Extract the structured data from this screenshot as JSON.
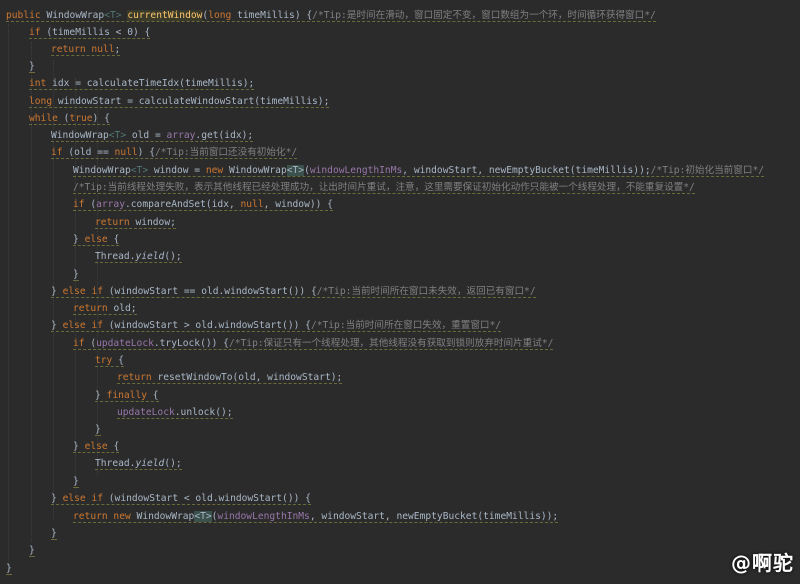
{
  "code_lines": [
    [
      [
        "kw",
        "public "
      ],
      [
        "pl",
        "WindowWrap"
      ],
      [
        "ty",
        "<T>"
      ],
      [
        "pl",
        " "
      ],
      [
        "hl",
        "currentWindow"
      ],
      [
        "pl",
        "("
      ],
      [
        "kw",
        "long "
      ],
      [
        "pl",
        "timeMillis) {"
      ],
      [
        "cm",
        "/*Tip:是时间在滑动，窗口固定不变，窗口数组为一个环，时间循环获得窗口*/"
      ]
    ],
    [
      [
        "kw",
        "if "
      ],
      [
        "pl",
        "(timeMillis < 0) {"
      ]
    ],
    [
      [
        "kw",
        "return null"
      ],
      [
        "pl",
        ";"
      ]
    ],
    [
      [
        "pl",
        "}"
      ]
    ],
    [
      [
        "kw",
        "int "
      ],
      [
        "pl",
        "idx = calculateTimeIdx(timeMillis);"
      ]
    ],
    [
      [
        "kw",
        "long "
      ],
      [
        "pl",
        "windowStart = calculateWindowStart(timeMillis);"
      ]
    ],
    [
      [
        "kw",
        "while "
      ],
      [
        "pl",
        "("
      ],
      [
        "kw",
        "true"
      ],
      [
        "pl",
        ") {"
      ]
    ],
    [
      [
        "pl",
        "WindowWrap"
      ],
      [
        "ty",
        "<T>"
      ],
      [
        "pl",
        " old = "
      ],
      [
        "fi",
        "array"
      ],
      [
        "pl",
        ".get(idx);"
      ]
    ],
    [
      [
        "kw",
        "if "
      ],
      [
        "pl",
        "(old == "
      ],
      [
        "kw",
        "null"
      ],
      [
        "pl",
        ") {"
      ],
      [
        "cm",
        "/*Tip:当前窗口还没有初始化*/"
      ]
    ],
    [
      [
        "pl",
        "WindowWrap"
      ],
      [
        "ty",
        "<T>"
      ],
      [
        "pl",
        " window = "
      ],
      [
        "kw",
        "new "
      ],
      [
        "pl",
        "WindowWrap"
      ],
      [
        "br",
        "<T>"
      ],
      [
        "pl",
        "("
      ],
      [
        "fi",
        "windowLengthInMs"
      ],
      [
        "pl",
        ", windowStart, newEmptyBucket(timeMillis));"
      ],
      [
        "cm",
        "/*Tip:初始化当前窗口*/"
      ]
    ],
    [
      [
        "cm",
        "/*Tip:当前线程处理失败，表示其他线程已经处理成功，让出时间片重试，注意，这里需要保证初始化动作只能被一个线程处理，不能重复设置*/"
      ]
    ],
    [
      [
        "kw",
        "if "
      ],
      [
        "pl",
        "("
      ],
      [
        "fi",
        "array"
      ],
      [
        "pl",
        ".compareAndSet(idx, "
      ],
      [
        "kw",
        "null"
      ],
      [
        "pl",
        ", window)) {"
      ]
    ],
    [
      [
        "kw",
        "return "
      ],
      [
        "pl",
        "window;"
      ]
    ],
    [
      [
        "pl",
        "} "
      ],
      [
        "kw",
        "else "
      ],
      [
        "pl",
        "{"
      ]
    ],
    [
      [
        "pl",
        "Thread."
      ],
      [
        "it",
        "yield"
      ],
      [
        "pl",
        "();"
      ]
    ],
    [
      [
        "pl",
        "}"
      ]
    ],
    [
      [
        "pl",
        "} "
      ],
      [
        "kw",
        "else if "
      ],
      [
        "pl",
        "(windowStart == old.windowStart()) {"
      ],
      [
        "cm",
        "/*Tip:当前时间所在窗口未失效，返回已有窗口*/"
      ]
    ],
    [
      [
        "kw",
        "return "
      ],
      [
        "pl",
        "old;"
      ]
    ],
    [
      [
        "pl",
        "} "
      ],
      [
        "kw",
        "else if "
      ],
      [
        "pl",
        "(windowStart > old.windowStart()) {"
      ],
      [
        "cm",
        "/*Tip:当前时间所在窗口失效，重置窗口*/"
      ]
    ],
    [
      [
        "kw",
        "if "
      ],
      [
        "pl",
        "("
      ],
      [
        "fi",
        "updateLock"
      ],
      [
        "pl",
        ".tryLock()) {"
      ],
      [
        "cm",
        "/*Tip:保证只有一个线程处理，其他线程没有获取到锁则放弃时间片重试*/"
      ]
    ],
    [
      [
        "kw",
        "try "
      ],
      [
        "pl",
        "{"
      ]
    ],
    [
      [
        "kw",
        "return "
      ],
      [
        "pl",
        "resetWindowTo(old, windowStart);"
      ]
    ],
    [
      [
        "pl",
        "} "
      ],
      [
        "kw",
        "finally "
      ],
      [
        "pl",
        "{"
      ]
    ],
    [
      [
        "fi",
        "updateLock"
      ],
      [
        "pl",
        ".unlock();"
      ]
    ],
    [
      [
        "pl",
        "}"
      ]
    ],
    [
      [
        "pl",
        "} "
      ],
      [
        "kw",
        "else "
      ],
      [
        "pl",
        "{"
      ]
    ],
    [
      [
        "pl",
        "Thread."
      ],
      [
        "it",
        "yield"
      ],
      [
        "pl",
        "();"
      ]
    ],
    [
      [
        "pl",
        "}"
      ]
    ],
    [
      [
        "pl",
        "} "
      ],
      [
        "kw",
        "else if "
      ],
      [
        "pl",
        "(windowStart < old.windowStart()) {"
      ]
    ],
    [
      [
        "kw",
        "return new "
      ],
      [
        "pl",
        "WindowWrap"
      ],
      [
        "br",
        "<T>"
      ],
      [
        "pl",
        "("
      ],
      [
        "fi",
        "windowLengthInMs"
      ],
      [
        "pl",
        ", windowStart, newEmptyBucket(timeMillis));"
      ]
    ],
    [
      [
        "pl",
        "}"
      ]
    ],
    [
      [
        "pl",
        "}"
      ]
    ],
    [
      [
        "pl",
        "}"
      ]
    ]
  ],
  "watermark": "@啊驼"
}
